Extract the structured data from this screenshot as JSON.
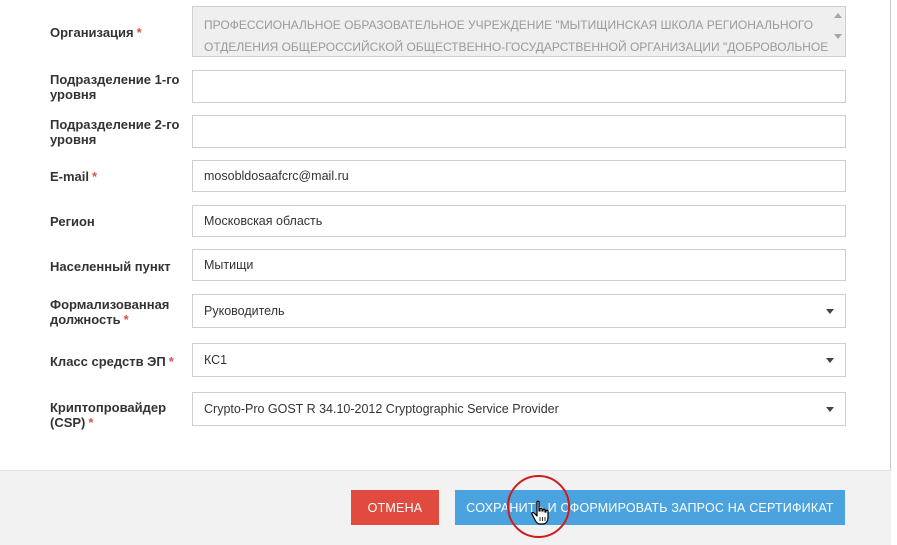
{
  "form": {
    "required_mark": "*",
    "organization": {
      "label": "Организация",
      "value_line1": "ПРОФЕССИОНАЛЬНОЕ ОБРАЗОВАТЕЛЬНОЕ УЧРЕЖДЕНИЕ \"МЫТИЩИНСКАЯ ШКОЛА РЕГИОНАЛЬНОГО",
      "value_line2": "ОТДЕЛЕНИЯ ОБЩЕРОССИЙСКОЙ ОБЩЕСТВЕННО-ГОСУДАРСТВЕННОЙ ОРГАНИЗАЦИИ \"ДОБРОВОЛЬНОЕ"
    },
    "division1": {
      "label": "Подразделение 1-го уровня",
      "value": ""
    },
    "division2": {
      "label": "Подразделение 2-го уровня",
      "value": ""
    },
    "email": {
      "label": "E-mail",
      "value": "mosobldosaafcrc@mail.ru"
    },
    "region": {
      "label": "Регион",
      "value": "Московская область"
    },
    "locality": {
      "label": "Населенный пункт",
      "value": "Мытищи"
    },
    "position": {
      "label": "Формализованная должность",
      "value": "Руководитель"
    },
    "ep_class": {
      "label": "Класс средств ЭП",
      "value": "КС1"
    },
    "csp": {
      "label": "Криптопровайдер (CSP)",
      "value": "Crypto-Pro GOST R 34.10-2012 Cryptographic Service Provider"
    }
  },
  "footer": {
    "cancel_label": "ОТМЕНА",
    "save_label": "СОХРАНИТЬ И СФОРМИРОВАТЬ ЗАПРОС НА СЕРТИФИКАТ"
  },
  "colors": {
    "cancel_button": "#e04a3f",
    "save_button": "#4aa3df",
    "required_mark": "#d9534f",
    "highlight_ring": "#d11a1a"
  },
  "icons": [
    "dropdown-caret-icon",
    "hand-pointer-cursor-icon",
    "scroll-up-icon",
    "scroll-down-icon"
  ]
}
